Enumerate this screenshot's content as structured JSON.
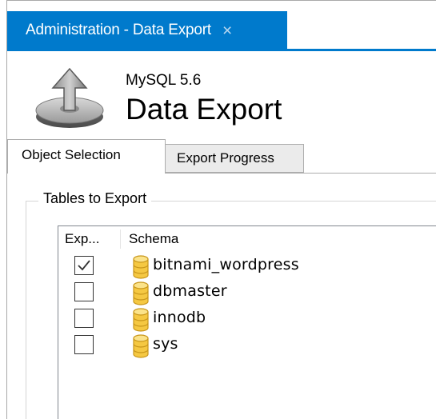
{
  "window": {
    "tab_title": "Administration - Data Export",
    "close_glyph": "×"
  },
  "header": {
    "subtitle": "MySQL 5.6",
    "title": "Data Export",
    "icon": "export-upload-icon"
  },
  "subtabs": [
    {
      "label": "Object Selection",
      "active": true
    },
    {
      "label": "Export Progress",
      "active": false
    }
  ],
  "tables_group": {
    "title": "Tables to Export",
    "columns": [
      "Exp...",
      "Schema"
    ],
    "rows": [
      {
        "schema": "bitnami_wordpress",
        "checked": true
      },
      {
        "schema": "dbmaster",
        "checked": false
      },
      {
        "schema": "innodb",
        "checked": false
      },
      {
        "schema": "sys",
        "checked": false
      }
    ]
  },
  "colors": {
    "accent": "#007acc",
    "db_icon_fill": "#f5c842",
    "db_icon_stroke": "#c8961a"
  }
}
